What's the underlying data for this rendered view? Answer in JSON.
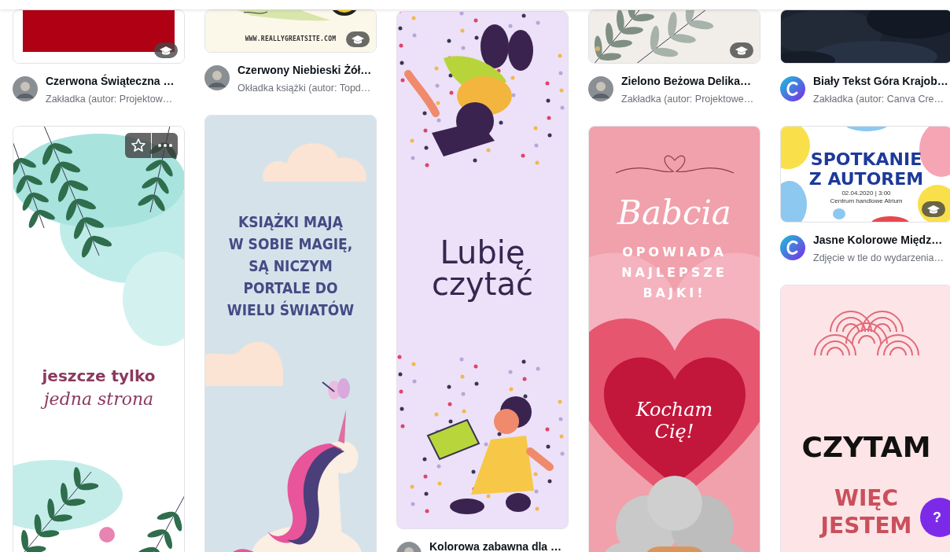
{
  "columns": [
    {
      "items": [
        {
          "kind": "red-card",
          "pro": true,
          "hovered": false,
          "caption": {
            "title": "Czerwona Świąteczna …",
            "subtitle": "Zakładka (autor: Projektow…"
          }
        },
        {
          "kind": "leaf-quote",
          "pro": false,
          "hovered": true,
          "texts": [
            {
              "kind": "bold",
              "lines": [
                "jeszcze tylko"
              ]
            },
            {
              "kind": "script",
              "lines": [
                "jedna strona"
              ]
            }
          ]
        }
      ]
    },
    {
      "items": [
        {
          "kind": "url-card",
          "pro": true,
          "hovered": false,
          "texts": [
            {
              "kind": "url",
              "lines": [
                "WWW.REALLYGREATSITE.COM"
              ]
            }
          ],
          "caption": {
            "title": "Czerwony Niebieski Żół…",
            "subtitle": "Okładka książki (autor: Topd…"
          }
        },
        {
          "kind": "unicorn",
          "pro": false,
          "hovered": false,
          "texts": [
            {
              "kind": "display",
              "lines": [
                "KSIĄŻKI MAJĄ",
                "W SOBIE MAGIĘ,",
                "SĄ NICZYM",
                "PORTALE DO",
                "WIELU ŚWIATÓW"
              ]
            }
          ]
        }
      ]
    },
    {
      "items": [
        {
          "kind": "reading-girls",
          "pro": false,
          "hovered": false,
          "texts": [
            {
              "kind": "handwritten",
              "lines": [
                "Lubię",
                "czytać"
              ]
            }
          ],
          "caption": {
            "title": "Kolorowa zabawna dla …"
          }
        }
      ]
    },
    {
      "items": [
        {
          "kind": "leaf-photo",
          "pro": true,
          "hovered": false,
          "caption": {
            "title": "Zielono Beżowa Delika…",
            "subtitle": "Zakładka (autor: Projektowe…"
          }
        },
        {
          "kind": "babcia",
          "pro": false,
          "hovered": false,
          "texts": [
            {
              "kind": "script-large",
              "lines": [
                "Babcia"
              ]
            },
            {
              "kind": "spaced",
              "lines": [
                "OPOWIADA",
                "NAJLEPSZE",
                "BAJKI!"
              ]
            },
            {
              "kind": "script-small",
              "lines": [
                "Kocham",
                "Cię!"
              ]
            }
          ]
        }
      ]
    },
    {
      "items": [
        {
          "kind": "dark-photo",
          "pro": false,
          "hovered": false,
          "caption": {
            "avatar": {
              "kind": "logo"
            },
            "title": "Biały Tekst Góra Krajob…",
            "subtitle": "Zakładka (autor: Canva Cre…"
          }
        },
        {
          "kind": "spotkanie",
          "pro": true,
          "hovered": false,
          "texts": [
            {
              "kind": "heavy",
              "lines": [
                "SPOTKANIE",
                "Z AUTOREM"
              ]
            },
            {
              "kind": "tiny",
              "lines": [
                "02.04.2020 | 3:00",
                "Centrum handlowe Atrium"
              ]
            }
          ],
          "caption": {
            "avatar": {
              "kind": "logo"
            },
            "title": "Jasne Kolorowe Międz…",
            "subtitle": "Zdjęcie w tle do wydarzenia…"
          }
        },
        {
          "kind": "czytam",
          "pro": false,
          "hovered": false,
          "texts": [
            {
              "kind": "black",
              "lines": [
                "CZYTAM"
              ]
            },
            {
              "kind": "red-bold",
              "lines": [
                "WIĘC",
                "JESTEM"
              ]
            }
          ]
        }
      ]
    }
  ],
  "help_button": {
    "label": "?"
  }
}
